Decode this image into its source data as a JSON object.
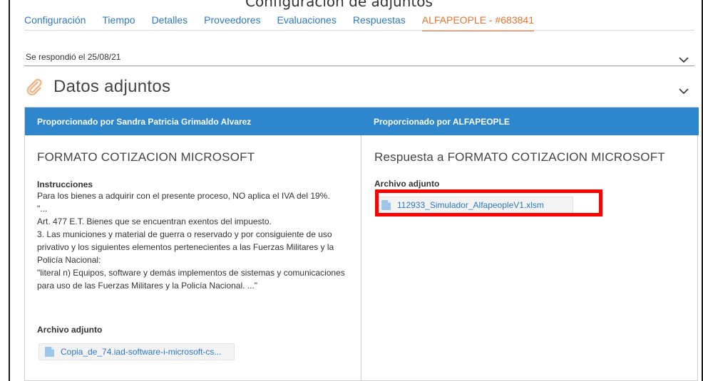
{
  "header": {
    "cropped_title": "Configuración de adjuntos"
  },
  "tabs": [
    {
      "label": "Configuración"
    },
    {
      "label": "Tiempo"
    },
    {
      "label": "Detalles"
    },
    {
      "label": "Proveedores"
    },
    {
      "label": "Evaluaciones"
    },
    {
      "label": "Respuestas"
    },
    {
      "label": "ALFAPEOPLE - #683841",
      "active": true
    }
  ],
  "response": {
    "status_text": "Se respondió el 25/08/21"
  },
  "attachments_section": {
    "title": "Datos adjuntos",
    "icon": "paperclip-icon"
  },
  "table": {
    "left_header": "Proporcionado por Sandra Patricia Grimaldo Alvarez",
    "right_header": "Proporcionado por ALFAPEOPLE",
    "left": {
      "doc_title": "FORMATO COTIZACION MICROSOFT",
      "instructions_label": "Instrucciones",
      "instructions_lines": [
        "Para los bienes a adquirir con el presente proceso, NO aplica el IVA del 19%.",
        "\"...",
        "Art. 477 E.T. Bienes que se encuentran exentos del impuesto.",
        "3. Las municiones y material de guerra o reservado y por consiguiente de uso privativo y los siguientes elementos pertenecientes a las Fuerzas Militares y la Policía Nacional:",
        "\"literal n) Equipos, software y demás implementos de sistemas y comunicaciones para uso de las Fuerzas Militares y la Policía Nacional. ...\""
      ],
      "attachment_label": "Archivo adjunto",
      "attachment_file": "Copia_de_74.iad-software-i-microsoft-cs..."
    },
    "right": {
      "doc_title": "Respuesta a FORMATO COTIZACION MICROSOFT",
      "attachment_label": "Archivo adjunto",
      "attachment_file": "112933_Simulador_AlfapeopleV1.xlsm"
    }
  },
  "colors": {
    "tab_link": "#2d78c6",
    "tab_active": "#e9732f",
    "table_header_bg": "#2e86cc",
    "highlight": "#ff0000"
  }
}
